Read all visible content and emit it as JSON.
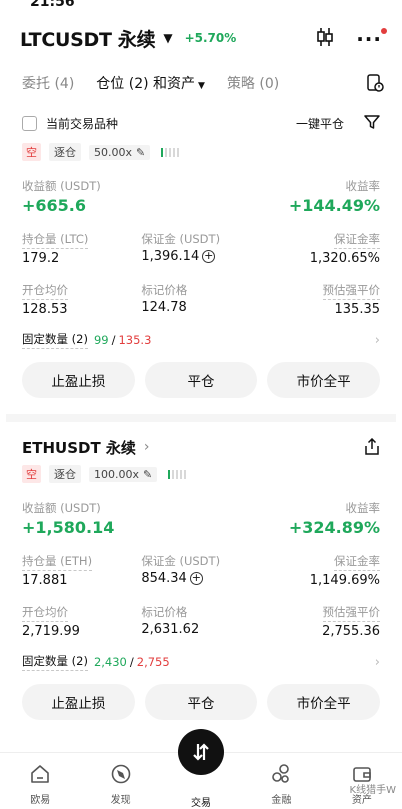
{
  "status": {
    "time": "21:56"
  },
  "header": {
    "symbol": "LTCUSDT 永续",
    "change": "+5.70%"
  },
  "tabs": [
    {
      "label": "委托 (4)",
      "active": false
    },
    {
      "label": "仓位 (2) 和资产",
      "active": true
    },
    {
      "label": "策略 (0)",
      "active": false
    }
  ],
  "filter": {
    "checkbox_label": "当前交易品种",
    "close_all": "一键平仓"
  },
  "positions": [
    {
      "side": "空",
      "margin_mode": "逐仓",
      "leverage": "50.00x",
      "pnl_label": "收益额 (USDT)",
      "pnl": "+665.6",
      "roi_label": "收益率",
      "roi": "+144.49%",
      "size_label": "持仓量 (LTC)",
      "size": "179.2",
      "margin_label": "保证金 (USDT)",
      "margin": "1,396.14",
      "margin_ratio_label": "保证金率",
      "margin_ratio": "1,320.65%",
      "entry_label": "开仓均价",
      "entry": "128.53",
      "mark_label": "标记价格",
      "mark": "124.78",
      "liq_label": "预估强平价",
      "liq": "135.35",
      "fixed_label": "固定数量 (2)",
      "fixed_green": "99",
      "fixed_sep": "/",
      "fixed_red": "135.3",
      "btn_tpsl": "止盈止损",
      "btn_close": "平仓",
      "btn_market_close": "市价全平",
      "risk_level": 0.2
    },
    {
      "title": "ETHUSDT 永续",
      "side": "空",
      "margin_mode": "逐仓",
      "leverage": "100.00x",
      "pnl_label": "收益额 (USDT)",
      "pnl": "+1,580.14",
      "roi_label": "收益率",
      "roi": "+324.89%",
      "size_label": "持仓量 (ETH)",
      "size": "17.881",
      "margin_label": "保证金 (USDT)",
      "margin": "854.34",
      "margin_ratio_label": "保证金率",
      "margin_ratio": "1,149.69%",
      "entry_label": "开仓均价",
      "entry": "2,719.99",
      "mark_label": "标记价格",
      "mark": "2,631.62",
      "liq_label": "预估强平价",
      "liq": "2,755.36",
      "fixed_label": "固定数量 (2)",
      "fixed_green": "2,430",
      "fixed_sep": "/",
      "fixed_red": "2,755",
      "btn_tpsl": "止盈止损",
      "btn_close": "平仓",
      "btn_market_close": "市价全平",
      "risk_level": 0.2
    }
  ],
  "nav": [
    {
      "label": "欧易",
      "icon": "home-icon"
    },
    {
      "label": "发现",
      "icon": "discover-icon"
    },
    {
      "label": "交易",
      "icon": "trade-icon"
    },
    {
      "label": "金融",
      "icon": "finance-icon"
    },
    {
      "label": "资产",
      "icon": "wallet-icon"
    }
  ],
  "watermark": "K线猎手W",
  "colors": {
    "green": "#1fa85b",
    "red": "#e23d3d",
    "accent_dark": "#111111"
  }
}
